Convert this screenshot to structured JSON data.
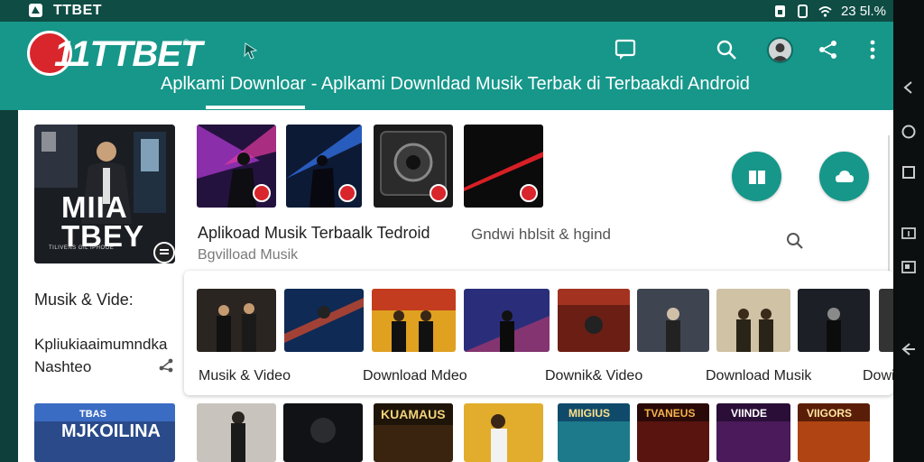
{
  "status_bar": {
    "app_name": "TTBET",
    "time": "23 5l.%"
  },
  "header": {
    "logo_text": "11TTBET",
    "title": "Aplkami Downloar - Aplkami Downldad Musik Terbak di Terbaakdi Android",
    "colors": {
      "teal": "#16978a",
      "red": "#d8262c"
    }
  },
  "featured": {
    "line1": "MIIA",
    "line2": "TBEY",
    "small_text": "TILIVENS GIL IPHOOE"
  },
  "top_row": {
    "tiles": [
      {
        "name": "concert-dj"
      },
      {
        "name": "singer-stage"
      },
      {
        "name": "speaker"
      },
      {
        "name": "red-light"
      }
    ],
    "caption1": "Aplikoad Musik Terbaalk Tedroid",
    "caption1_sub": "Bgvilload Musik",
    "caption2": "Gndwi hblsit & hgind"
  },
  "sidebar": {
    "section1": "Musik & Vide:",
    "section2_line1": "Kpliukiaaimumndka",
    "section2_line2": "Nashteo"
  },
  "cards_panel": {
    "thumb_count": 11,
    "labels": [
      "Musik & Video",
      "Download Mdeo",
      "Downik& Video",
      "Download Musik",
      "Dowi"
    ]
  },
  "bottom": {
    "featured_line1": "TBAS",
    "featured_line2": "MJKOILINA",
    "thumb_texts": [
      "",
      "",
      "KUAMAUS",
      "",
      "MIIGIUS",
      "TVANEUS",
      "VIINDE",
      "VIIGORS"
    ]
  },
  "icons": {
    "header": [
      "chat-icon",
      "search-icon",
      "avatar",
      "share-icon",
      "more-vert-icon"
    ],
    "nav": [
      "back-icon",
      "home-icon",
      "recents-icon",
      "tv-icon",
      "cast-icon",
      "back-arrow-icon"
    ]
  }
}
